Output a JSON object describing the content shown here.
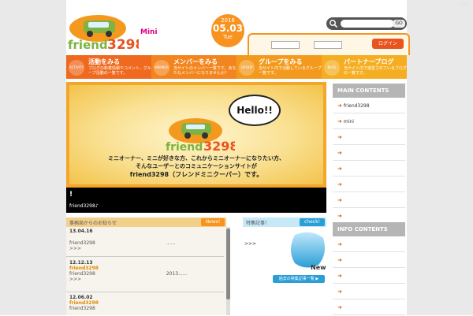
{
  "header": {
    "brand_mini": "Mini",
    "date_year": "2016",
    "date_day": "05.03",
    "date_weekday": "Tue",
    "search_button": "GO",
    "login_button": "ログイン"
  },
  "nav": {
    "items": [
      {
        "icon_label": "ACTIVITY",
        "title": "活動をみる",
        "desc": "ブログの新着情報やコメント、グループ活動の一覧です。",
        "color": "#ef6a1e"
      },
      {
        "icon_label": "MEMBER",
        "title": "メンバーをみる",
        "desc": "当サイトのメンバー一覧です。あなたもメンバーになりませんか？",
        "color": "#f3851e"
      },
      {
        "icon_label": "GROUP",
        "title": "グループをみる",
        "desc": "当サイト内で活動しているグループ一覧です。",
        "color": "#f39a1e"
      },
      {
        "icon_label": "BLOG",
        "title": "パートナーブログ",
        "desc": "当サイト内で運営されているブログの一覧です。",
        "color": "#f5ae22"
      }
    ]
  },
  "hero": {
    "bubble": "Hello!!",
    "line1": "ミニオーナー、ミニが好きな方、これからミニオーナーになりたい方、",
    "line2": "そんなユーザーとのコミュニケーションサイトが",
    "line3": "friend3298（フレンドミニクーパー）です。",
    "bar_title": "!",
    "bar_sub": "friend3298♪"
  },
  "news": {
    "title": "事務局からのお知らせ",
    "badge": "News!",
    "entries": [
      {
        "date": "13.04.16",
        "more": ">>>",
        "author": "",
        "text": "friend3298",
        "extra": "......"
      },
      {
        "date": "12.12.13",
        "more": ">>>",
        "author": "friend3298",
        "text": "friend3298",
        "extra": "2013......"
      },
      {
        "date": "12.06.02",
        "more": "",
        "author": "friend3298",
        "text": "friend3298",
        "extra": ""
      }
    ]
  },
  "feature": {
    "title": "特集記事！",
    "badge": "check!",
    "arrows": ">>>",
    "icon_text": "New",
    "more_link": "過去の特集記事一覧 ▶"
  },
  "sidebar": {
    "main_title": "MAIN CONTENTS",
    "main_items": [
      "friend3298",
      "mini",
      "",
      "",
      "",
      "",
      "",
      ""
    ],
    "info_title": "INFO CONTENTS",
    "info_items": [
      "",
      "",
      "",
      "",
      ""
    ]
  },
  "colors": {
    "accent_orange": "#f7931e",
    "login_red": "#e8531e",
    "feature_blue": "#2a9fd6",
    "brand_pink": "#e4007f"
  }
}
